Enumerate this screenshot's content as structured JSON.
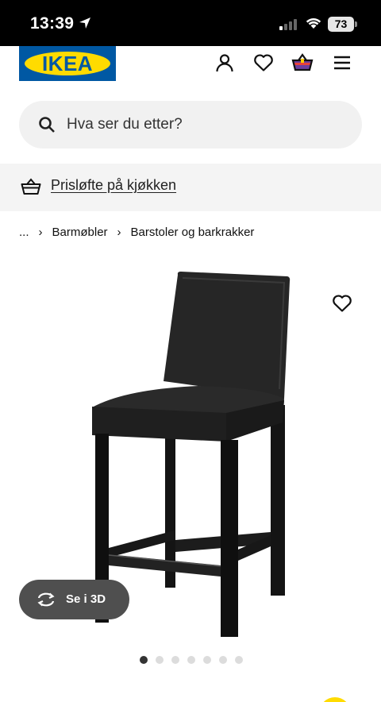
{
  "status_bar": {
    "time": "13:39",
    "battery": "73",
    "icons": [
      "location-arrow-icon",
      "cellular-signal-icon",
      "wifi-icon",
      "battery-icon"
    ]
  },
  "header": {
    "logo_text": "IKEA",
    "icons": [
      "account-icon",
      "heart-icon",
      "shopping-basket-icon",
      "menu-icon"
    ],
    "colors": {
      "brand_blue": "#0058a3",
      "brand_yellow": "#ffdb00"
    }
  },
  "search": {
    "placeholder": "Hva ser du etter?",
    "icon": "search-icon"
  },
  "promo": {
    "icon": "price-promise-basket-icon",
    "link_label": "Prisløfte på kjøkken"
  },
  "breadcrumb": {
    "items": [
      "...",
      "Barmøbler",
      "Barstoler og barkrakker"
    ]
  },
  "product": {
    "image_label": "barstool-black-leather-image",
    "favorite_icon": "heart-icon",
    "view_3d_label": "Se i 3D",
    "view_3d_icon": "rotate-3d-icon"
  },
  "carousel": {
    "total_images": 7,
    "active_index": 0
  }
}
